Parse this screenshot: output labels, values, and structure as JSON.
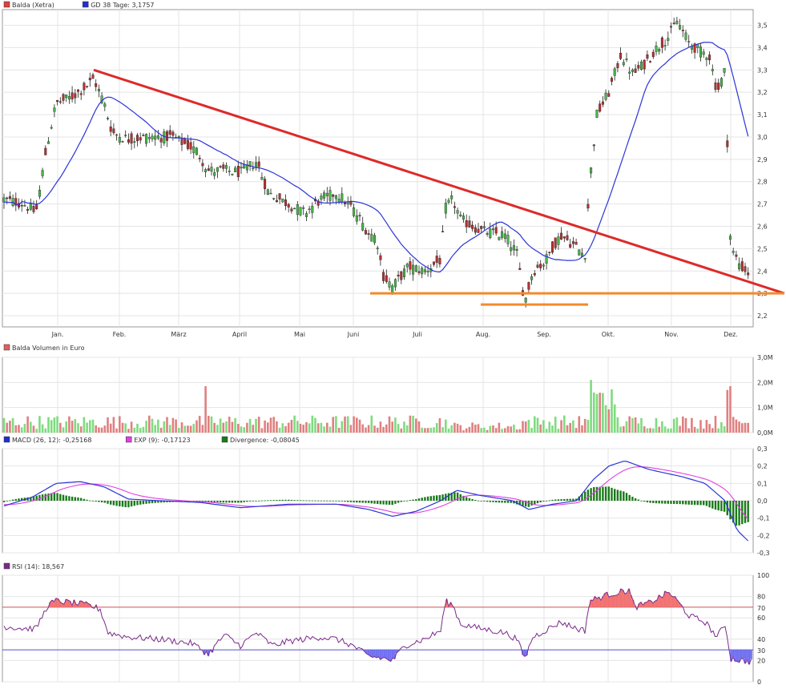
{
  "legends": {
    "price": [
      {
        "label": "Balda (Xetra)",
        "color": "#e04040"
      },
      {
        "label": "GD 38 Tage: 3,1757",
        "color": "#2030d0"
      }
    ],
    "volume": [
      {
        "label": "Balda Volumen in Euro",
        "color": "#e06060"
      }
    ],
    "macd": [
      {
        "label": "MACD (26, 12): -0,25168",
        "color": "#1f2fd0"
      },
      {
        "label": "EXP (9): -0,17123",
        "color": "#e040e0"
      },
      {
        "label": "Divergence: -0,08045",
        "color": "#1a7a1a"
      }
    ],
    "rsi": [
      {
        "label": "RSI (14): 18,567",
        "color": "#7a2a8a"
      }
    ]
  },
  "colors": {
    "up": "#49b649",
    "down": "#b83030",
    "wick": "#222222",
    "ma": "#2b35d6",
    "trend": "#dd2a2a",
    "support": "#f28a2e",
    "macd": "#2b35d6",
    "signal": "#e040e0",
    "divergence": "#1a7a1a",
    "rsi": "#7a2a8a",
    "overbought": "#f07070",
    "oversold": "#7070f0",
    "vol_up": "#7fdb7f",
    "vol_down": "#e08080"
  },
  "chart_data": [
    {
      "panel": "price",
      "type": "line",
      "title": "",
      "ylabel": "",
      "x_labels": [
        "Jan.",
        "Feb.",
        "März",
        "April",
        "Mai",
        "Juni",
        "Juli",
        "Aug.",
        "Sep.",
        "Okt.",
        "Nov.",
        "Dez."
      ],
      "y_ticks": [
        "2,2",
        "2,3",
        "2,4",
        "2,5",
        "2,6",
        "2,7",
        "2,8",
        "2,9",
        "3,0",
        "3,1",
        "3,2",
        "3,3",
        "3,4",
        "3,5"
      ],
      "ylim": [
        2.15,
        3.57
      ],
      "series": [
        {
          "name": "Balda (Xetra)",
          "kind": "candlestick",
          "monthly_closes": [
            2.72,
            3.2,
            3.0,
            2.95,
            2.8,
            2.68,
            2.4,
            2.58,
            2.32,
            2.5,
            3.35,
            3.38,
            2.4
          ]
        },
        {
          "name": "GD 38 Tage",
          "kind": "moving average",
          "value": 3.1757
        }
      ],
      "annotations": {
        "downtrend_line_from": 3.3,
        "downtrend_line_to": 2.3,
        "support_long": 2.3,
        "support_short": 2.25
      }
    },
    {
      "panel": "volume",
      "type": "bar",
      "title": "",
      "y_ticks": [
        "0,0M",
        "1,0M",
        "2,0M",
        "3,0M"
      ],
      "ylim": [
        0,
        3.0
      ],
      "series": [
        {
          "name": "Balda Volumen in Euro",
          "max": 2.1
        }
      ]
    },
    {
      "panel": "macd",
      "type": "line",
      "title": "",
      "y_ticks": [
        "-0,3",
        "-0,2",
        "-0,1",
        "0,0",
        "0,1",
        "0,2",
        "0,3"
      ],
      "ylim": [
        -0.3,
        0.3
      ],
      "series": [
        {
          "name": "MACD (26, 12)",
          "last": -0.25168
        },
        {
          "name": "EXP (9)",
          "last": -0.17123
        },
        {
          "name": "Divergence",
          "last": -0.08045
        }
      ]
    },
    {
      "panel": "rsi",
      "type": "line",
      "title": "",
      "y_ticks": [
        "0",
        "20",
        "40",
        "60",
        "80",
        "100"
      ],
      "ylim": [
        0,
        100
      ],
      "levels": [
        {
          "value": 70,
          "label": "70"
        },
        {
          "value": 30,
          "label": "30"
        }
      ],
      "series": [
        {
          "name": "RSI (14)",
          "last": 18.567
        }
      ]
    }
  ]
}
